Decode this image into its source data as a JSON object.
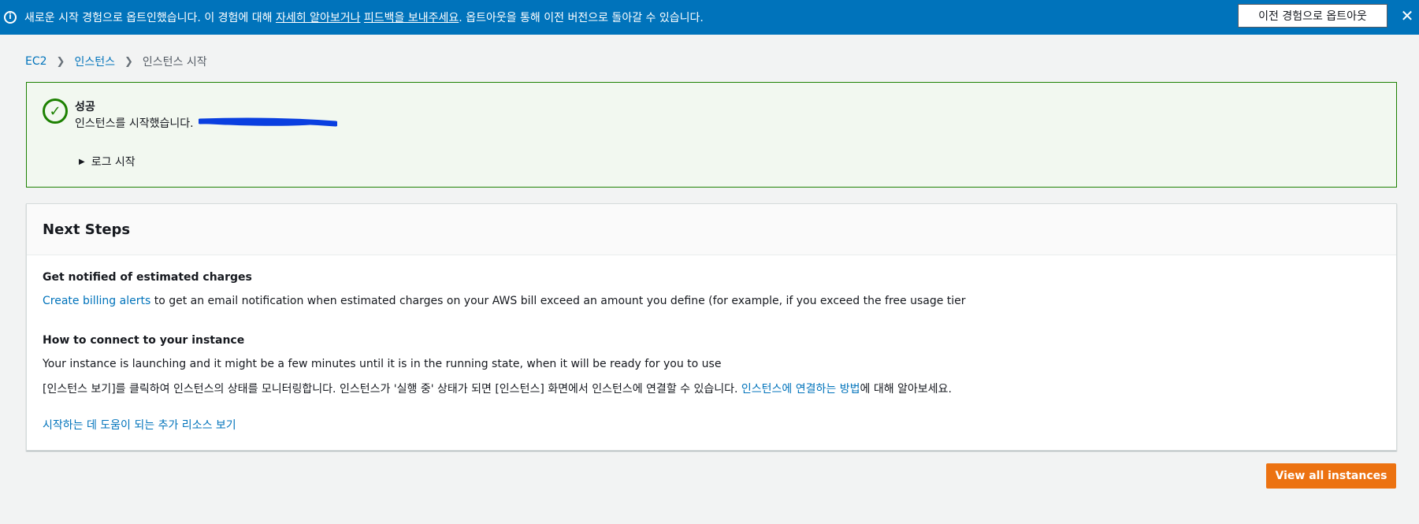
{
  "banner": {
    "message_pre": "새로운 시작 경험으로 옵트인했습니다. 이 경험에 대해 ",
    "learn_more_link": "자세히 알아보거나",
    "message_mid": " ",
    "feedback_link": "피드백을 보내주세요",
    "message_post": ". 옵트아웃을 통해 이전 버전으로 돌아갈 수 있습니다.",
    "optout_button": "이전 경험으로 옵트아웃",
    "close_glyph": "✕"
  },
  "breadcrumb": {
    "items": [
      "EC2",
      "인스턴스"
    ],
    "current": "인스턴스 시작"
  },
  "success": {
    "title": "성공",
    "message": "인스턴스를 시작했습니다.",
    "logs_toggle": "로그 시작"
  },
  "next_steps": {
    "title": "Next Steps",
    "charges": {
      "heading": "Get notified of estimated charges",
      "link": "Create billing alerts",
      "text": " to get an email notification when estimated charges on your AWS bill exceed an amount you define (for example, if you exceed the free usage tier"
    },
    "connect": {
      "heading": "How to connect to your instance",
      "line1": "Your instance is launching and it might be a few minutes until it is in the running state, when it will be ready for you to use",
      "line2_pre": "[인스턴스 보기]를 클릭하여 인스턴스의 상태를 모니터링합니다. 인스턴스가 '실행 중' 상태가 되면 [인스턴스] 화면에서 인스턴스에 연결할 수 있습니다. ",
      "line2_link": "인스턴스에 연결하는 방법",
      "line2_post": "에 대해 알아보세요."
    },
    "resources_link": "시작하는 데 도움이 되는 추가 리소스 보기"
  },
  "actions": {
    "view_all": "View all instances"
  },
  "colors": {
    "banner": "#0073bb",
    "success_border": "#1d8102",
    "link": "#0073bb",
    "primary": "#ec7211"
  }
}
